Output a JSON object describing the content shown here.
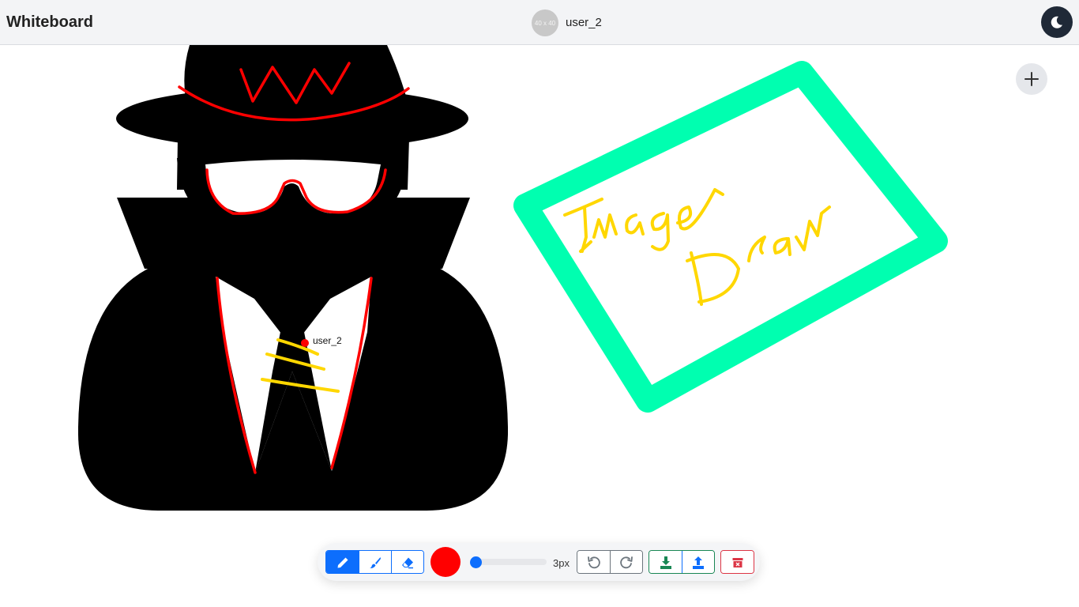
{
  "header": {
    "title": "Whiteboard",
    "avatar_text": "40 x 40",
    "username": "user_2",
    "theme_toggle_icon": "moon-icon"
  },
  "canvas": {
    "add_icon": "plus-icon",
    "remote_cursor": {
      "username": "user_2",
      "color": "#ff0000"
    },
    "handwritten_text": [
      "Image",
      "Draw"
    ]
  },
  "toolbar": {
    "tools": [
      {
        "name": "pencil",
        "icon": "pencil-icon",
        "active": true
      },
      {
        "name": "brush",
        "icon": "brush-icon",
        "active": false
      },
      {
        "name": "eraser",
        "icon": "eraser-icon",
        "active": false
      }
    ],
    "selected_color": "#ff0000",
    "brush_size_label": "3px",
    "brush_size": 3,
    "undo_icon": "undo-icon",
    "redo_icon": "redo-icon",
    "download_icon": "download-icon",
    "upload_icon": "upload-icon",
    "clear_icon": "trash-icon"
  },
  "colors": {
    "accent": "#0d6efd",
    "stroke_red": "#ff0000",
    "stroke_yellow": "#ffd700",
    "stroke_green": "#00ffb0",
    "danger": "#dc3545",
    "success": "#198754"
  }
}
